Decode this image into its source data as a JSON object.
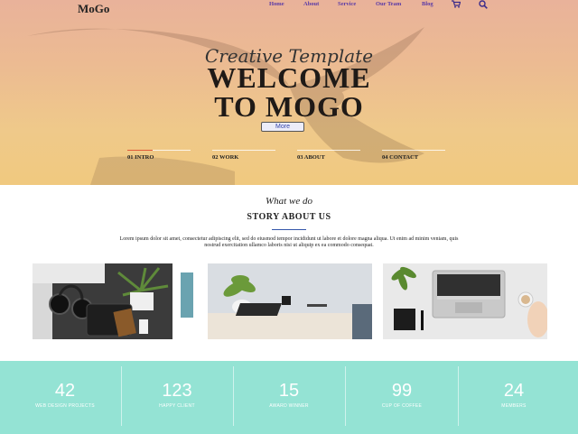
{
  "brand": "MoGo",
  "nav": {
    "items": [
      "Home",
      "About",
      "Service",
      "Our Team",
      "Blog"
    ],
    "icons": [
      "cart-icon",
      "search-icon"
    ]
  },
  "hero": {
    "tagline": "Creative Template",
    "headline_line1": "WELCOME",
    "headline_line2": "TO MOGO",
    "more_label": "More",
    "tabs": [
      "01 INTRO",
      "02 WORK",
      "03 ABOUT",
      "04 CONTACT"
    ]
  },
  "story": {
    "subtitle": "What we do",
    "title": "STORY ABOUT US",
    "text": "Lorem ipsum dolor sit amet, consectetur adipiscing elit, sed do eiusmod tempor incididunt ut labore et dolore magna aliqua. Ut enim ad minim veniam, quis nostrud exercitation ullamco laboris nisi ut aliquip ex ea commodo consequat."
  },
  "stats": [
    {
      "value": "42",
      "label": "WEB DESIGN PROJECTS"
    },
    {
      "value": "123",
      "label": "HAPPY CLIENT"
    },
    {
      "value": "15",
      "label": "AWARD WINNER"
    },
    {
      "value": "99",
      "label": "CUP OF COFFEE"
    },
    {
      "value": "24",
      "label": "MEMBERS"
    }
  ],
  "colors": {
    "nav_link": "#5a3aa6",
    "stats_bg": "#94e3d4",
    "tab_accent": "#e05a3a"
  }
}
